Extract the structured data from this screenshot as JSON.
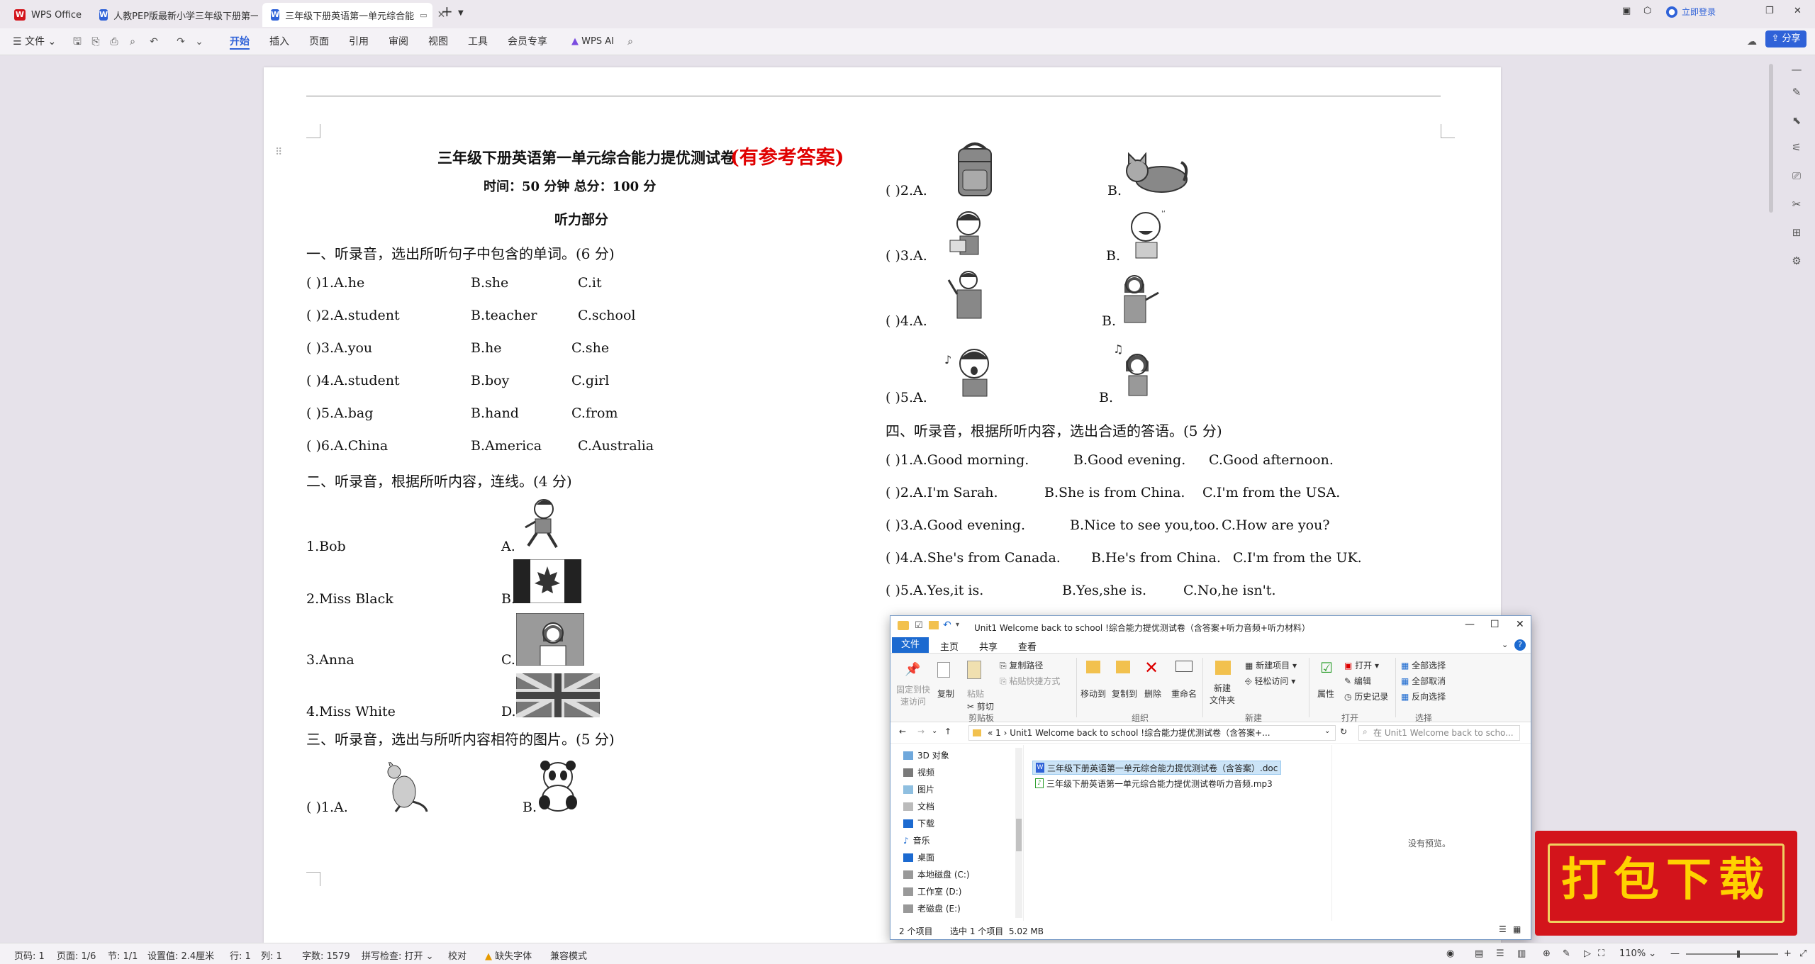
{
  "titlebar": {
    "tabs": [
      {
        "label": "WPS Office"
      },
      {
        "label": "人教PEP版最新小学三年级下册第一单"
      },
      {
        "label": "三年级下册英语第一单元综合能"
      }
    ],
    "new_tab": "+",
    "login": "立即登录"
  },
  "ribbon": {
    "file_menu": "文件",
    "items": [
      "开始",
      "插入",
      "页面",
      "引用",
      "审阅",
      "视图",
      "工具",
      "会员专享"
    ],
    "wps_ai": "WPS AI",
    "share": "分享"
  },
  "doc": {
    "title": "三年级下册英语第一单元综合能力提优测试卷",
    "title_red": "(有参考答案)",
    "time_line": "时间：50 分钟   总分：100 分",
    "listening": "听力部分",
    "s1_heading": "一、听录音，选出所听句子中包含的单词。(6 分)",
    "s1_rows": [
      {
        "n": "(          )1.A.he",
        "b": "B.she",
        "c": "C.it"
      },
      {
        "n": "(          )2.A.student",
        "b": "B.teacher",
        "c": "C.school"
      },
      {
        "n": "(          )3.A.you",
        "b": "B.he",
        "c": "C.she"
      },
      {
        "n": "(          )4.A.student",
        "b": "B.boy",
        "c": "C.girl"
      },
      {
        "n": "(          )5.A.bag",
        "b": "B.hand",
        "c": "C.from"
      },
      {
        "n": "(          )6.A.China",
        "b": "B.America",
        "c": "C.Australia"
      }
    ],
    "s2_heading": "二、听录音，根据所听内容，连线。(4 分)",
    "s2_rows": [
      {
        "name": "1.Bob",
        "opt": "A."
      },
      {
        "name": "2.Miss Black",
        "opt": "B."
      },
      {
        "name": "3.Anna",
        "opt": "C."
      },
      {
        "name": "4.Miss White",
        "opt": "D."
      }
    ],
    "s3_heading": "三、听录音，选出与所听内容相符的图片。(5 分)",
    "s3_rows": [
      {
        "a": "(          )1.A.",
        "b": "B."
      },
      {
        "a": "(          )2.A.",
        "b": "B."
      },
      {
        "a": "(          )3.A.",
        "b": "B."
      },
      {
        "a": "(          )4.A.",
        "b": "B."
      },
      {
        "a": "(          )5.A.",
        "b": "B."
      }
    ],
    "s4_heading": "四、听录音，根据所听内容，选出合适的答语。(5 分)",
    "s4_rows": [
      {
        "a": "(          )1.A.Good morning.",
        "b": "B.Good evening.",
        "c": "C.Good afternoon."
      },
      {
        "a": "(          )2.A.I'm Sarah.",
        "b": "B.She is from China.",
        "c": "C.I'm from the USA."
      },
      {
        "a": "(          )3.A.Good evening.",
        "b": "B.Nice to see you,too.",
        "c": "C.How are you?"
      },
      {
        "a": "(          )4.A.She's from Canada.",
        "b": "B.He's from China.",
        "c": "C.I'm from the UK."
      },
      {
        "a": "(          )5.A.Yes,it is.",
        "b": "B.Yes,she is.",
        "c": "C.No,he isn't."
      }
    ]
  },
  "statusbar": {
    "page": "页码: 1",
    "pages": "页面: 1/6",
    "section": "节: 1/1",
    "setting": "设置值: 2.4厘米",
    "row": "行: 1",
    "col": "列: 1",
    "words": "字数: 1579",
    "spell": "拼写检查: 打开",
    "proof": "校对",
    "missing_font": "缺失字体",
    "compat": "兼容模式",
    "zoom": "110%"
  },
  "explorer": {
    "title": "Unit1 Welcome back to school !综合能力提优测试卷（含答案+听力音频+听力材料）",
    "tabs": {
      "file": "文件",
      "home": "主页",
      "share": "共享",
      "view": "查看"
    },
    "ribbon": {
      "pin": "固定到快\n速访问",
      "copy": "复制",
      "paste": "粘贴",
      "copy_path": "复制路径",
      "paste_shortcut": "粘贴快捷方式",
      "cut": "剪切",
      "clipboard": "剪贴板",
      "move_to": "移动到",
      "copy_to": "复制到",
      "delete": "删除",
      "rename": "重命名",
      "organize": "组织",
      "new_folder": "新建\n文件夹",
      "new_item": "新建项目",
      "easy_access": "轻松访问",
      "new": "新建",
      "properties": "属性",
      "open": "打开",
      "edit": "编辑",
      "history": "历史记录",
      "open_grp": "打开",
      "select_all": "全部选择",
      "select_none": "全部取消",
      "invert": "反向选择",
      "select": "选择"
    },
    "address": "« 1 › Unit1 Welcome back to school !综合能力提优测试卷（含答案+...",
    "search_placeholder": "在 Unit1 Welcome back to scho...",
    "nav": [
      "3D 对象",
      "视频",
      "图片",
      "文档",
      "下载",
      "音乐",
      "桌面",
      "本地磁盘 (C:)",
      "工作室 (D:)",
      "老磁盘 (E:)"
    ],
    "files": [
      "三年级下册英语第一单元综合能力提优测试卷（含答案）.doc",
      "三年级下册英语第一单元综合能力提优测试卷听力音频.mp3"
    ],
    "no_preview": "没有预览。",
    "status_count": "2 个项目",
    "status_sel": "选中 1 个项目  5.02 MB"
  },
  "badge": {
    "text": "打包下载"
  }
}
